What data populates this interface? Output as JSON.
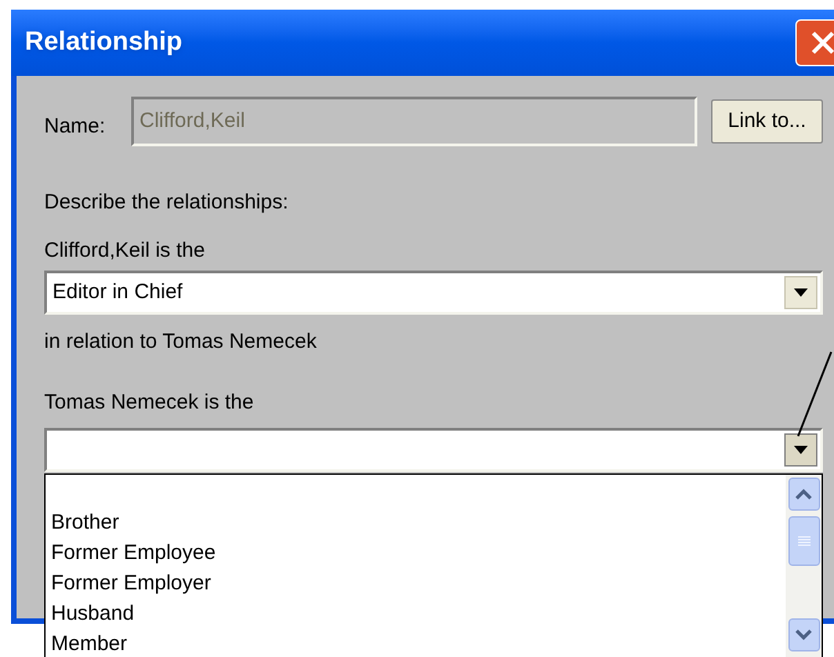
{
  "window": {
    "title": "Relationship"
  },
  "name_field": {
    "label": "Name:",
    "value": "Clifford,Keil",
    "disabled": true
  },
  "link_button": {
    "label": "Link to..."
  },
  "instruction": "Describe the relationships:",
  "first_relation": {
    "label": "Clifford,Keil is the",
    "value": "Editor in Chief"
  },
  "relation_note": "in relation to Tomas Nemecek",
  "second_relation": {
    "label": "Tomas Nemecek is the",
    "expanded": true
  },
  "dropdown_items": [
    "Brother",
    "Former Employee",
    "Former Employer",
    "Husband",
    "Member"
  ]
}
